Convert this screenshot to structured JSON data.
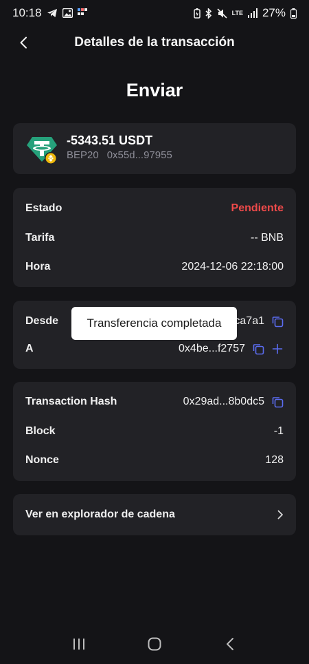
{
  "status_bar": {
    "time": "10:18",
    "battery": "27%",
    "network": "LTE"
  },
  "header": {
    "title": "Detalles de la transacción"
  },
  "page_title": "Enviar",
  "asset": {
    "amount": "-5343.51 USDT",
    "network": "BEP20",
    "contract": "0x55d...97955",
    "icon": "tether-usdt-icon"
  },
  "details": {
    "status_label": "Estado",
    "status_value": "Pendiente",
    "fee_label": "Tarifa",
    "fee_value": "-- BNB",
    "time_label": "Hora",
    "time_value": "2024-12-06 22:18:00"
  },
  "addresses": {
    "from_label": "Desde",
    "from_value_visible": "ca7a1",
    "to_label": "A",
    "to_value": "0x4be...f2757"
  },
  "chain_info": {
    "hash_label": "Transaction Hash",
    "hash_value": "0x29ad...8b0dc5",
    "block_label": "Block",
    "block_value": "-1",
    "nonce_label": "Nonce",
    "nonce_value": "128"
  },
  "explorer": {
    "label": "Ver en explorador de cadena"
  },
  "toast": {
    "message": "Transferencia completada"
  },
  "colors": {
    "background": "#141417",
    "card": "#222226",
    "pending": "#ef4a4a",
    "accent_icon": "#5b6cf0",
    "tether": "#26a17b"
  }
}
